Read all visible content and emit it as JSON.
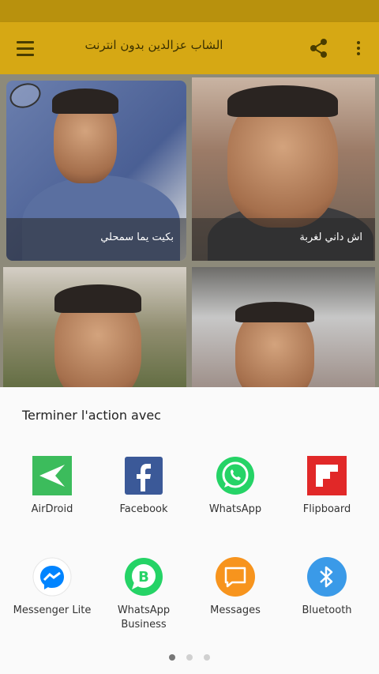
{
  "app_bar": {
    "title": "الشاب عزالدين بدون انترنت",
    "menu_icon": "hamburger-menu-icon",
    "share_icon": "share-icon",
    "more_icon": "more-vert-icon"
  },
  "songs": [
    {
      "caption": "بكيت يما سمحلي"
    },
    {
      "caption": "اش داني لغربة"
    },
    {
      "caption": ""
    },
    {
      "caption": ""
    }
  ],
  "share_sheet": {
    "title": "Terminer l'action avec",
    "apps": [
      {
        "label": "AirDroid",
        "icon": "airdroid-icon",
        "color": "#3cbc5c"
      },
      {
        "label": "Facebook",
        "icon": "facebook-icon",
        "color": "#3b5998"
      },
      {
        "label": "WhatsApp",
        "icon": "whatsapp-icon",
        "color": "#25d366"
      },
      {
        "label": "Flipboard",
        "icon": "flipboard-icon",
        "color": "#e12828"
      },
      {
        "label": "Messenger Lite",
        "icon": "messenger-lite-icon",
        "color": "#0084ff"
      },
      {
        "label": "WhatsApp Business",
        "icon": "whatsapp-business-icon",
        "color": "#25d366"
      },
      {
        "label": "Messages",
        "icon": "messages-icon",
        "color": "#f7941d"
      },
      {
        "label": "Bluetooth",
        "icon": "bluetooth-icon",
        "color": "#3a9ae8"
      }
    ],
    "page_count": 3,
    "current_page": 1
  }
}
